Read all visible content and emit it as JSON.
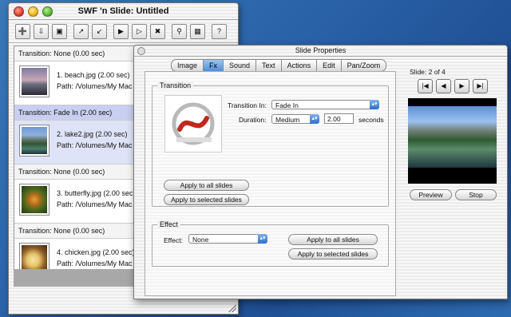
{
  "main_window": {
    "title": "SWF 'n Slide: Untitled",
    "toolbar_icons": [
      "new-slide-icon",
      "import-icon",
      "save-icon",
      "zoom-in-icon",
      "zoom-out-icon",
      "folder-icon",
      "folder-open-icon",
      "trash-icon",
      "search-icon",
      "export-icon",
      "help-icon"
    ],
    "rows": [
      {
        "kind": "transition",
        "label": "Transition: None (0.00 sec)"
      },
      {
        "kind": "slide",
        "name": "1. beach.jpg (2.00 sec)",
        "path": "Path: /Volumes/My Mac"
      },
      {
        "kind": "transition",
        "label": "Transition: Fade In (2.00 sec)",
        "selected": true
      },
      {
        "kind": "slide",
        "name": "2. lake2.jpg (2.00 sec)",
        "path": "Path: /Volumes/My Mac",
        "selected": true
      },
      {
        "kind": "transition",
        "label": "Transition: None (0.00 sec)"
      },
      {
        "kind": "slide",
        "name": "3. butterfly.jpg (2.00 sec)",
        "path": "Path: /Volumes/My Mac"
      },
      {
        "kind": "transition",
        "label": "Transition: None (0.00 sec)"
      },
      {
        "kind": "slide",
        "name": "4. chicken.jpg (2.00 sec)",
        "path": "Path: /Volumes/My Mac"
      }
    ]
  },
  "properties": {
    "title": "Slide Properties",
    "tabs": [
      "Image",
      "Fx",
      "Sound",
      "Text",
      "Actions",
      "Edit",
      "Pan/Zoom"
    ],
    "active_tab": "Fx",
    "transition": {
      "group_label": "Transition",
      "transition_in_label": "Transition In:",
      "transition_in_value": "Fade In",
      "duration_label": "Duration:",
      "duration_value": "Medium",
      "seconds_value": "2.00",
      "seconds_label": "seconds",
      "apply_all": "Apply to all slides",
      "apply_selected": "Apply to selected slides"
    },
    "effect": {
      "group_label": "Effect",
      "effect_label": "Effect:",
      "effect_value": "None",
      "apply_all": "Apply to all slides",
      "apply_selected": "Apply to selected slides"
    },
    "slide_counter": "Slide:   2 of 4",
    "preview_button": "Preview",
    "stop_button": "Stop"
  }
}
